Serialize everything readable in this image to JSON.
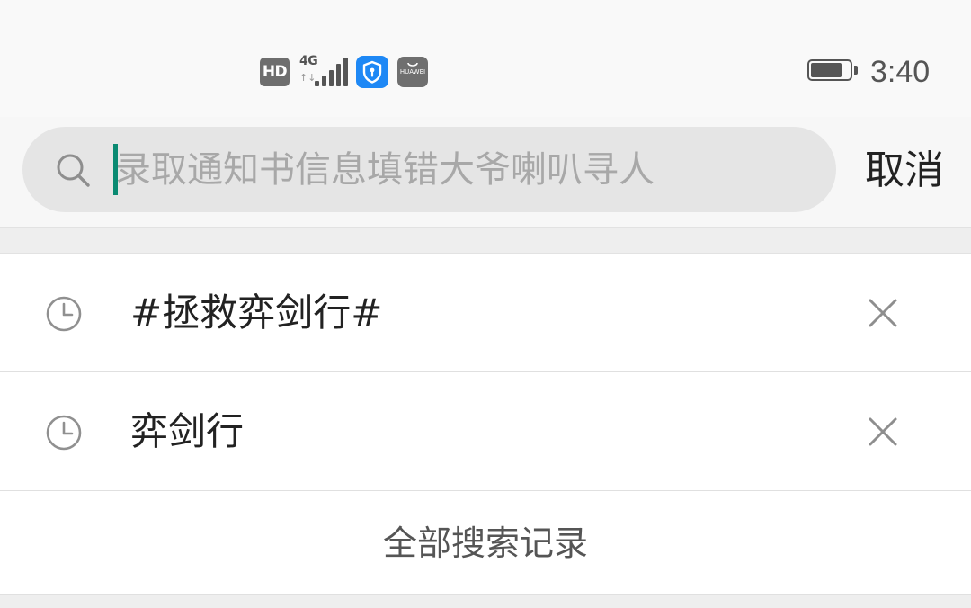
{
  "status_bar": {
    "hd_label": "HD",
    "network_type": "4G",
    "network_activity": "↑↓",
    "signal_bars": 5,
    "app_icons": [
      "shield-app-icon",
      "huawei-appgallery-icon"
    ],
    "huawei_label": "HUAWEI",
    "battery_level": 0.82,
    "time": "3:40"
  },
  "search": {
    "placeholder": "录取通知书信息填错大爷喇叭寻人",
    "value": "",
    "icon": "search-icon",
    "cancel_label": "取消"
  },
  "history": {
    "items": [
      {
        "label": "#拯救弈剑行#",
        "icon": "clock-icon",
        "action_icon": "close-icon"
      },
      {
        "label": "弈剑行",
        "icon": "clock-icon",
        "action_icon": "close-icon"
      }
    ],
    "all_label": "全部搜索记录"
  },
  "colors": {
    "caret": "#0a8a72",
    "shield_app": "#1e88f5",
    "search_bg": "#e5e5e5",
    "placeholder": "#a8a8a8"
  }
}
